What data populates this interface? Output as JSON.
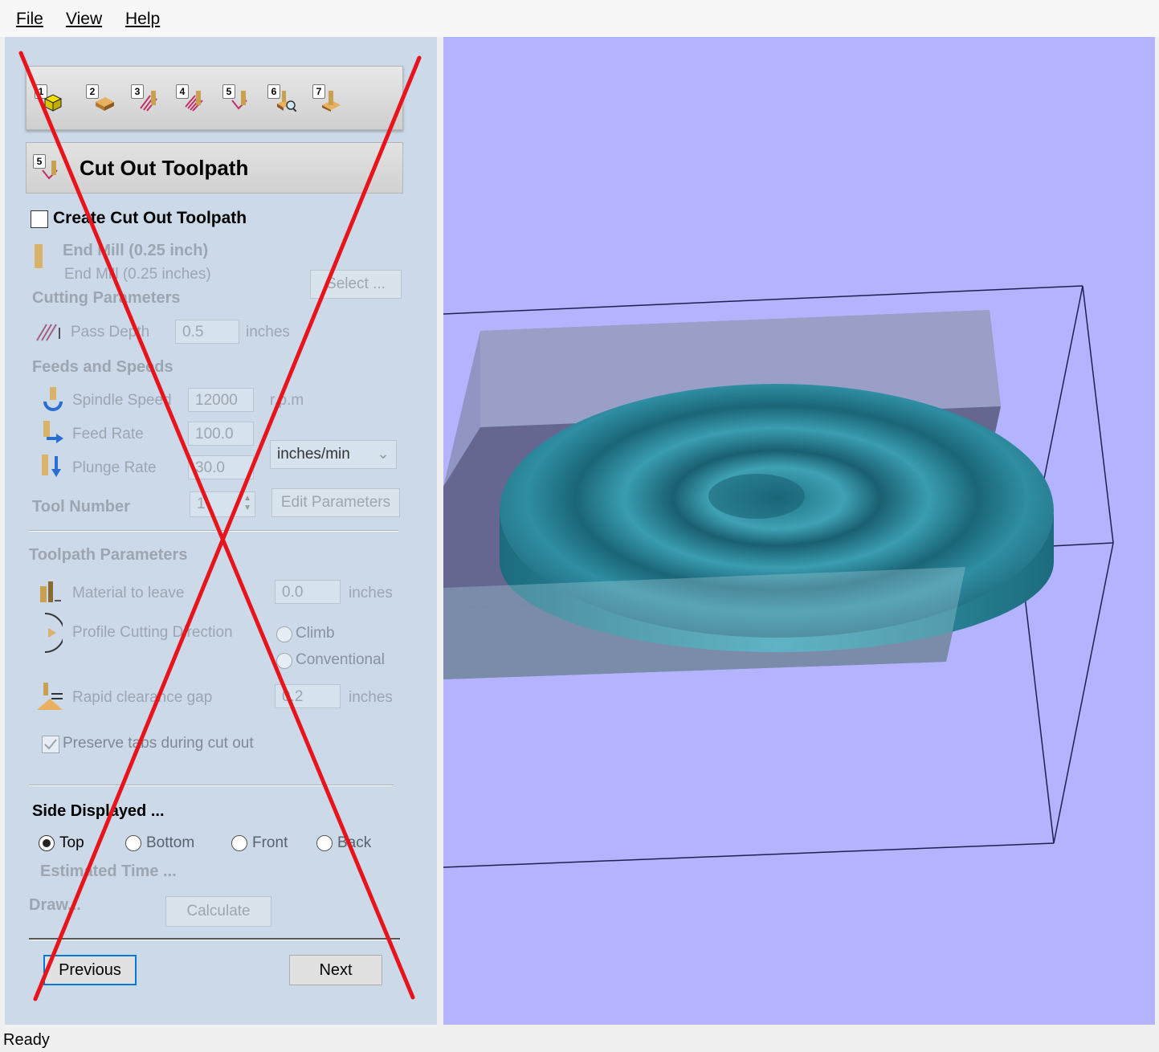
{
  "menu": {
    "file": "File",
    "view": "View",
    "help": "Help"
  },
  "toolbar": {
    "steps": [
      "1",
      "2",
      "3",
      "4",
      "5",
      "6",
      "7"
    ]
  },
  "panel": {
    "step_badge": "5",
    "title": "Cut Out Toolpath",
    "create_label": "Create Cut Out Toolpath",
    "tool_name": "End Mill (0.25 inch)",
    "tool_desc": "End Mill (0.25 inches)",
    "select_button": "Select ...",
    "cutting_params_heading": "Cutting Parameters",
    "pass_depth_label": "Pass Depth",
    "pass_depth_value": "0.5",
    "pass_depth_unit": "inches",
    "feeds_heading": "Feeds and Speeds",
    "spindle_label": "Spindle Speed",
    "spindle_value": "12000",
    "spindle_unit": "r.p.m",
    "feed_label": "Feed Rate",
    "feed_value": "100.0",
    "plunge_label": "Plunge Rate",
    "plunge_value": "30.0",
    "rate_unit_select": "inches/min",
    "tool_number_label": "Tool Number",
    "tool_number_value": "1",
    "edit_params_button": "Edit Parameters",
    "toolpath_params_heading": "Toolpath Parameters",
    "material_leave_label": "Material to leave",
    "material_leave_value": "0.0",
    "material_leave_unit": "inches",
    "profile_dir_label": "Profile Cutting Direction",
    "climb_label": "Climb",
    "conventional_label": "Conventional",
    "rapid_gap_label": "Rapid clearance gap",
    "rapid_gap_value": "0.2",
    "rapid_gap_unit": "inches",
    "preserve_tabs_label": "Preserve tabs during cut out",
    "side_heading": "Side Displayed ...",
    "side_top": "Top",
    "side_bottom": "Bottom",
    "side_front": "Front",
    "side_back": "Back",
    "estimated_time": "Estimated Time ...",
    "draw_label": "Draw...",
    "calculate_button": "Calculate",
    "previous_button": "Previous",
    "next_button": "Next"
  },
  "status": {
    "text": "Ready"
  },
  "colors": {
    "panel_bg": "#cbd9e8",
    "viewport_bg": "#b3b3ff",
    "part": "#2e8fa0",
    "cross": "#e8141c"
  }
}
